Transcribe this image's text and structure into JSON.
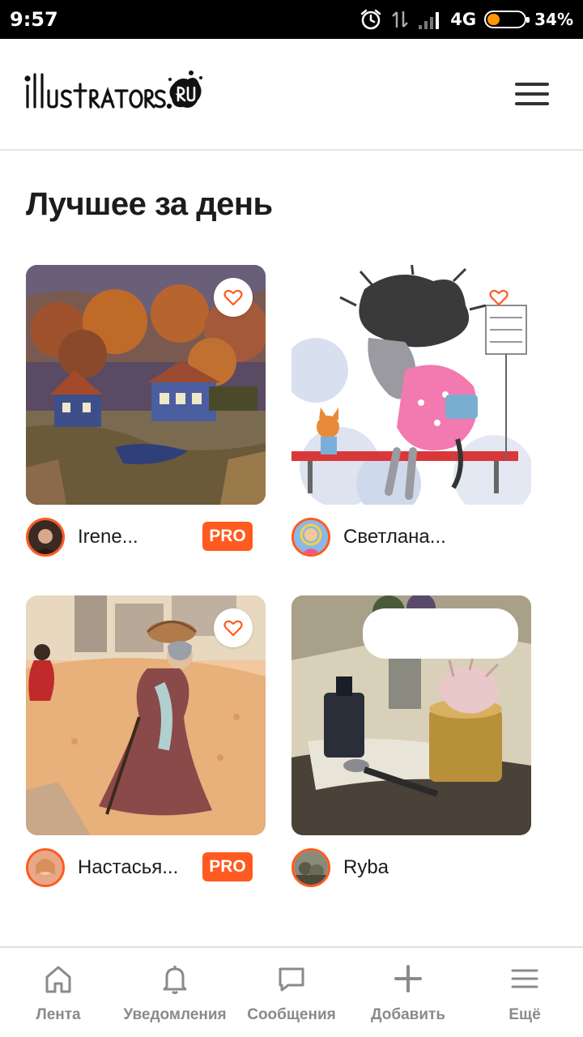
{
  "status_bar": {
    "time": "9:57",
    "network": "4G",
    "battery_percent": "34%",
    "battery_level": 0.34,
    "icons": [
      "alarm-icon",
      "data-arrows-icon",
      "signal-icon",
      "battery-icon"
    ]
  },
  "header": {
    "logo_text": "illustrators.ru",
    "menu_icon": "hamburger-icon"
  },
  "section": {
    "title": "Лучшее за день"
  },
  "cards": [
    {
      "author": "Irene...",
      "pro": "PRO",
      "like_icon": "heart-icon"
    },
    {
      "author": "Светлана...",
      "like_icon": "heart-icon"
    },
    {
      "author": "Настасья...",
      "pro": "PRO",
      "like_icon": "heart-icon"
    },
    {
      "author": "Ryba"
    }
  ],
  "bottom_nav": [
    {
      "label": "Лента",
      "icon": "home-icon"
    },
    {
      "label": "Уведомления",
      "icon": "bell-icon"
    },
    {
      "label": "Сообщения",
      "icon": "chat-icon"
    },
    {
      "label": "Добавить",
      "icon": "plus-icon"
    },
    {
      "label": "Ещё",
      "icon": "menu-icon"
    }
  ],
  "colors": {
    "accent": "#ff5a1f",
    "text": "#1c1c1c",
    "nav_gray": "#8a8a8a"
  }
}
